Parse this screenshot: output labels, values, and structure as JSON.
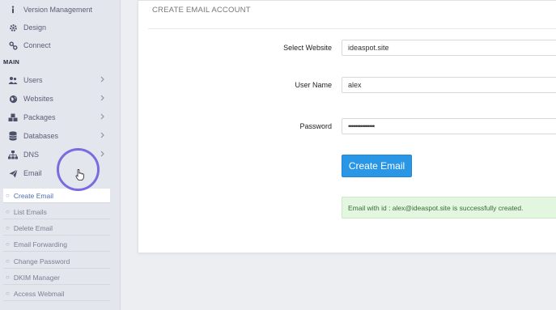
{
  "sidebar": {
    "top_items": [
      {
        "label": "Version Management",
        "icon": "info-icon"
      },
      {
        "label": "Design",
        "icon": "gear-icon"
      },
      {
        "label": "Connect",
        "icon": "connect-icon"
      }
    ],
    "section_label": "MAIN",
    "main_items": [
      {
        "label": "Users",
        "icon": "users-icon"
      },
      {
        "label": "Websites",
        "icon": "globe-icon"
      },
      {
        "label": "Packages",
        "icon": "cubes-icon"
      },
      {
        "label": "Databases",
        "icon": "database-icon"
      },
      {
        "label": "DNS",
        "icon": "sitemap-icon"
      },
      {
        "label": "Email",
        "icon": "paper-plane-icon"
      }
    ],
    "email_submenu": [
      {
        "label": "Create Email",
        "active": true
      },
      {
        "label": "List Emails"
      },
      {
        "label": "Delete Email"
      },
      {
        "label": "Email Forwarding"
      },
      {
        "label": "Change Password"
      },
      {
        "label": "DKIM Manager"
      },
      {
        "label": "Access Webmail"
      }
    ]
  },
  "main": {
    "title": "CREATE EMAIL ACCOUNT",
    "fields": {
      "website_label": "Select Website",
      "website_value": "ideaspot.site",
      "username_label": "User Name",
      "username_value": "alex",
      "password_label": "Password",
      "password_value": "•••••••••••••••"
    },
    "create_button": "Create Email",
    "success_message": "Email with id : alex@ideaspot.site is successfully created."
  },
  "colors": {
    "accent": "#2996e6",
    "success_bg": "#e3f6df",
    "cursor_ring": "#7a6be0"
  }
}
